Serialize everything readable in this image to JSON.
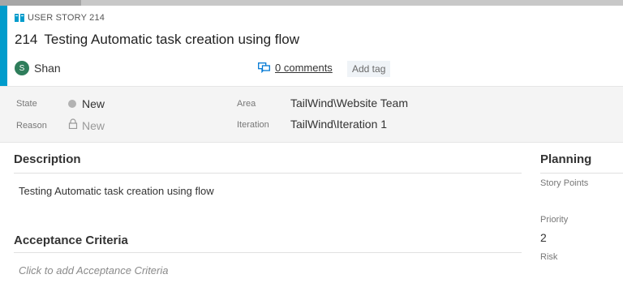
{
  "colors": {
    "accent": "#009ccc",
    "user_story_icon": "#009ccc",
    "avatar_bg": "#2e7d5b",
    "state_dot": "#b2b2b2"
  },
  "header": {
    "type_icon": "book-icon",
    "type_label": "USER STORY 214",
    "id": "214",
    "title": "Testing Automatic task creation using flow",
    "assignee": {
      "initial": "S",
      "name": "Shan"
    },
    "comments_icon": "comments-icon",
    "comments_link": "0 comments",
    "add_tag": "Add tag"
  },
  "fields": {
    "state": {
      "label": "State",
      "value": "New"
    },
    "reason": {
      "label": "Reason",
      "value": "New"
    },
    "area": {
      "label": "Area",
      "value": "TailWind\\Website Team"
    },
    "iteration": {
      "label": "Iteration",
      "value": "TailWind\\Iteration 1"
    }
  },
  "description": {
    "title": "Description",
    "text": "Testing Automatic task creation using flow"
  },
  "acceptance": {
    "title": "Acceptance Criteria",
    "placeholder": "Click to add Acceptance Criteria"
  },
  "planning": {
    "title": "Planning",
    "story_points_label": "Story Points",
    "story_points_value": "",
    "priority_label": "Priority",
    "priority_value": "2",
    "risk_label": "Risk"
  }
}
